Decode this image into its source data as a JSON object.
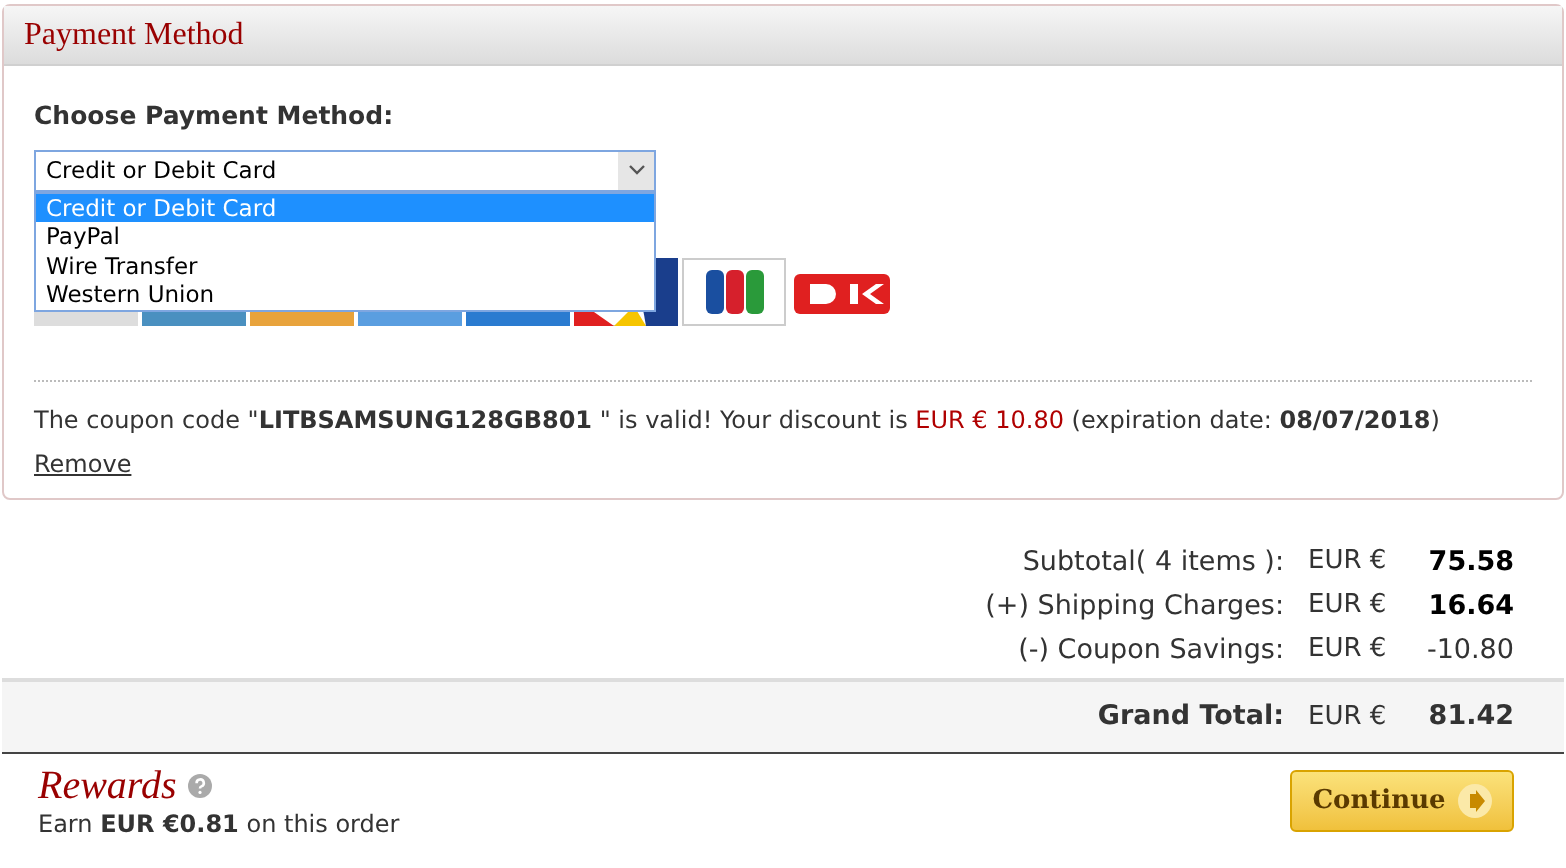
{
  "panel": {
    "title": "Payment Method"
  },
  "payment_select": {
    "label": "Choose Payment Method:",
    "value": "Credit or Debit Card",
    "expanded": true,
    "options": [
      {
        "label": "Credit or Debit Card",
        "selected": true
      },
      {
        "label": "PayPal",
        "selected": false
      },
      {
        "label": "Wire Transfer",
        "selected": false
      },
      {
        "label": "Western Union",
        "selected": false
      }
    ]
  },
  "coupon": {
    "text_before": "The coupon code \"**LITBSAMSUNG128GB801** \" is valid! Your discount is",
    "discount": "EUR € 10.80",
    "text_after": "(expiration date: **08/07/2018**)",
    "remove_link": "Remove"
  },
  "summary": [
    {
      "label": "Subtotal( 4 items ):",
      "currency": "EUR €",
      "amount": "75.58",
      "bold": true
    },
    {
      "label": "(+) Shipping Charges:",
      "currency": "EUR €",
      "amount": "16.64",
      "bold": true
    },
    {
      "label": "(-) Coupon Savings:",
      "currency": "EUR €",
      "amount": "-10.80",
      "bold": false
    }
  ],
  "grand_total": {
    "label": "Grand Total:",
    "currency": "EUR €",
    "amount": "81.42"
  },
  "rewards": {
    "title": "Rewards",
    "text": "Earn **EUR €0.81** on this order"
  },
  "continue_button": {
    "label": "Continue"
  }
}
